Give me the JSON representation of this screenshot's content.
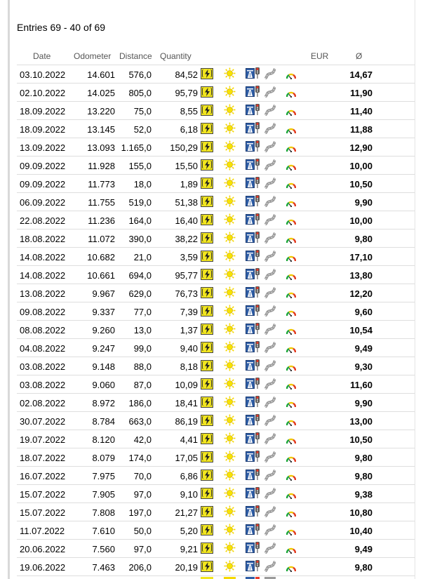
{
  "entries_label": "Entries 69 - 40 of 69",
  "columns": {
    "date": "Date",
    "odometer": "Odometer",
    "distance": "Distance",
    "quantity": "Quantity",
    "currency": "EUR",
    "average": "Ø"
  },
  "icons": {
    "fuel": "fuel-type-icon",
    "weather": "sun-icon",
    "route": "motorway-icon",
    "city": "traffic-light-icon",
    "country": "curvy-road-icon",
    "style": "driving-style-gauge-icon"
  },
  "colors": {
    "fuel_icon_bg": "#f1e51f",
    "sun": "#f5d800",
    "motorway": "#2f5ea6",
    "gauge_good": "#1ea83c"
  },
  "rows": [
    {
      "date": "03.10.2022",
      "odometer": "14.601",
      "distance": "576,0",
      "quantity": "84,52",
      "avg": "14,67"
    },
    {
      "date": "02.10.2022",
      "odometer": "14.025",
      "distance": "805,0",
      "quantity": "95,79",
      "avg": "11,90"
    },
    {
      "date": "18.09.2022",
      "odometer": "13.220",
      "distance": "75,0",
      "quantity": "8,55",
      "avg": "11,40"
    },
    {
      "date": "18.09.2022",
      "odometer": "13.145",
      "distance": "52,0",
      "quantity": "6,18",
      "avg": "11,88"
    },
    {
      "date": "13.09.2022",
      "odometer": "13.093",
      "distance": "1.165,0",
      "quantity": "150,29",
      "avg": "12,90"
    },
    {
      "date": "09.09.2022",
      "odometer": "11.928",
      "distance": "155,0",
      "quantity": "15,50",
      "avg": "10,00"
    },
    {
      "date": "09.09.2022",
      "odometer": "11.773",
      "distance": "18,0",
      "quantity": "1,89",
      "avg": "10,50"
    },
    {
      "date": "06.09.2022",
      "odometer": "11.755",
      "distance": "519,0",
      "quantity": "51,38",
      "avg": "9,90"
    },
    {
      "date": "22.08.2022",
      "odometer": "11.236",
      "distance": "164,0",
      "quantity": "16,40",
      "avg": "10,00"
    },
    {
      "date": "18.08.2022",
      "odometer": "11.072",
      "distance": "390,0",
      "quantity": "38,22",
      "avg": "9,80"
    },
    {
      "date": "14.08.2022",
      "odometer": "10.682",
      "distance": "21,0",
      "quantity": "3,59",
      "avg": "17,10"
    },
    {
      "date": "14.08.2022",
      "odometer": "10.661",
      "distance": "694,0",
      "quantity": "95,77",
      "avg": "13,80"
    },
    {
      "date": "13.08.2022",
      "odometer": "9.967",
      "distance": "629,0",
      "quantity": "76,73",
      "avg": "12,20"
    },
    {
      "date": "09.08.2022",
      "odometer": "9.337",
      "distance": "77,0",
      "quantity": "7,39",
      "avg": "9,60"
    },
    {
      "date": "08.08.2022",
      "odometer": "9.260",
      "distance": "13,0",
      "quantity": "1,37",
      "avg": "10,54"
    },
    {
      "date": "04.08.2022",
      "odometer": "9.247",
      "distance": "99,0",
      "quantity": "9,40",
      "avg": "9,49"
    },
    {
      "date": "03.08.2022",
      "odometer": "9.148",
      "distance": "88,0",
      "quantity": "8,18",
      "avg": "9,30"
    },
    {
      "date": "03.08.2022",
      "odometer": "9.060",
      "distance": "87,0",
      "quantity": "10,09",
      "avg": "11,60"
    },
    {
      "date": "02.08.2022",
      "odometer": "8.972",
      "distance": "186,0",
      "quantity": "18,41",
      "avg": "9,90"
    },
    {
      "date": "30.07.2022",
      "odometer": "8.784",
      "distance": "663,0",
      "quantity": "86,19",
      "avg": "13,00"
    },
    {
      "date": "19.07.2022",
      "odometer": "8.120",
      "distance": "42,0",
      "quantity": "4,41",
      "avg": "10,50"
    },
    {
      "date": "18.07.2022",
      "odometer": "8.079",
      "distance": "174,0",
      "quantity": "17,05",
      "avg": "9,80"
    },
    {
      "date": "16.07.2022",
      "odometer": "7.975",
      "distance": "70,0",
      "quantity": "6,86",
      "avg": "9,80"
    },
    {
      "date": "15.07.2022",
      "odometer": "7.905",
      "distance": "97,0",
      "quantity": "9,10",
      "avg": "9,38"
    },
    {
      "date": "15.07.2022",
      "odometer": "7.808",
      "distance": "197,0",
      "quantity": "21,27",
      "avg": "10,80"
    },
    {
      "date": "11.07.2022",
      "odometer": "7.610",
      "distance": "50,0",
      "quantity": "5,20",
      "avg": "10,40"
    },
    {
      "date": "20.06.2022",
      "odometer": "7.560",
      "distance": "97,0",
      "quantity": "9,21",
      "avg": "9,49"
    },
    {
      "date": "19.06.2022",
      "odometer": "7.463",
      "distance": "206,0",
      "quantity": "20,19",
      "avg": "9,80"
    }
  ]
}
